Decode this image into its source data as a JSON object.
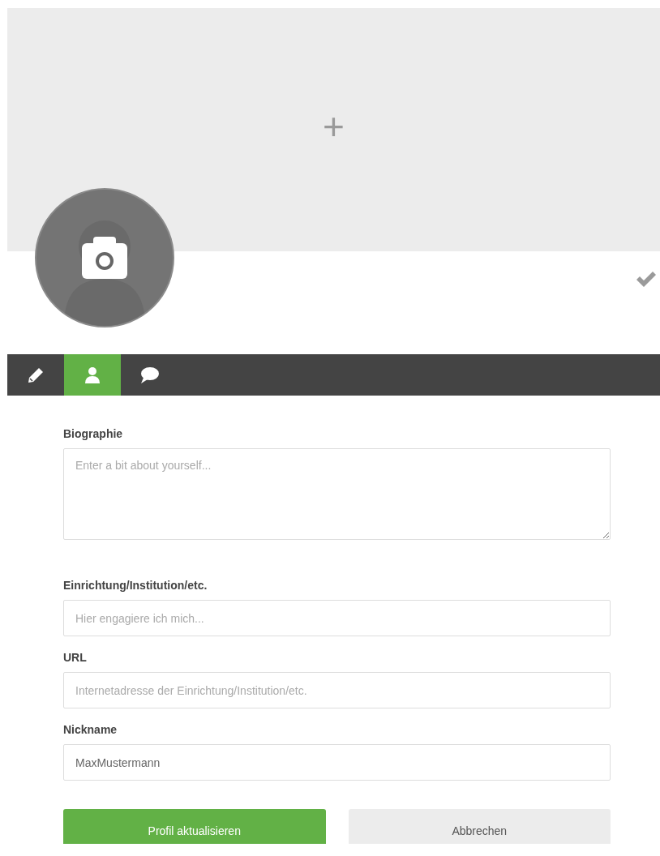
{
  "cover": {
    "add_label": "+"
  },
  "tabs": [
    {
      "kind": "edit",
      "selected": false
    },
    {
      "kind": "profile",
      "selected": true
    },
    {
      "kind": "comments",
      "selected": false
    }
  ],
  "form": {
    "fields": [
      {
        "kind": "textarea",
        "label": "Biographie",
        "placeholder": "Enter a bit about yourself..."
      },
      {
        "kind": "text",
        "label": "Einrichtung/Institution/etc.",
        "placeholder": "Hier engagiere ich mich..."
      },
      {
        "kind": "text",
        "label": "URL",
        "placeholder": "Internetadresse der Einrichtung/Institution/etc."
      },
      {
        "kind": "text",
        "label": "Nickname",
        "value": "MaxMustermann"
      }
    ]
  },
  "buttons": [
    {
      "kind": "primary",
      "label": "Profil aktualisieren"
    },
    {
      "kind": "secondary",
      "label": "Abbrechen"
    }
  ]
}
